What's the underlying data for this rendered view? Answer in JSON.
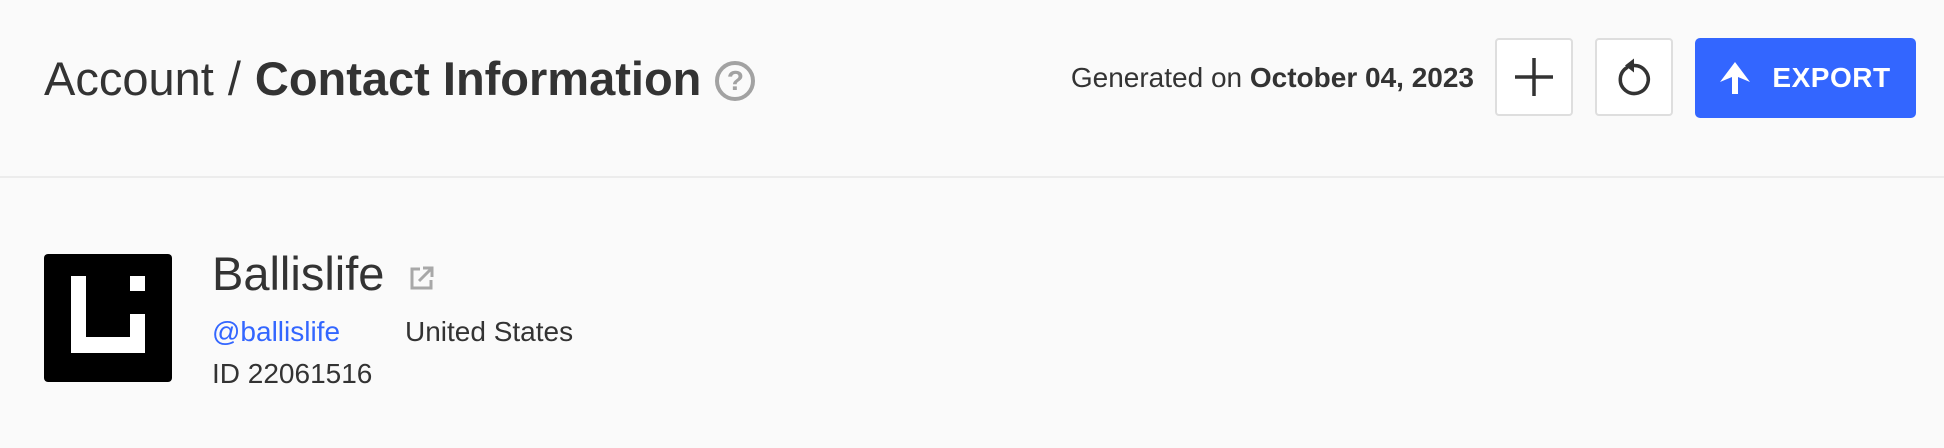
{
  "header": {
    "breadcrumb_root": "Account",
    "breadcrumb_separator": "/",
    "breadcrumb_current": "Contact Information",
    "help_icon": "?",
    "generated_prefix": "Generated on",
    "generated_date": "October 04, 2023",
    "export_label": "EXPORT",
    "add_icon": "plus-icon",
    "refresh_icon": "refresh-icon",
    "export_icon": "upload-arrow-icon",
    "accent_color": "#3366ff"
  },
  "profile": {
    "name": "Ballislife",
    "handle": "@ballislife",
    "country": "United States",
    "account_id": "ID 22061516",
    "logo_icon": "ballislife-logo",
    "external_link_icon": "external-link-icon"
  }
}
